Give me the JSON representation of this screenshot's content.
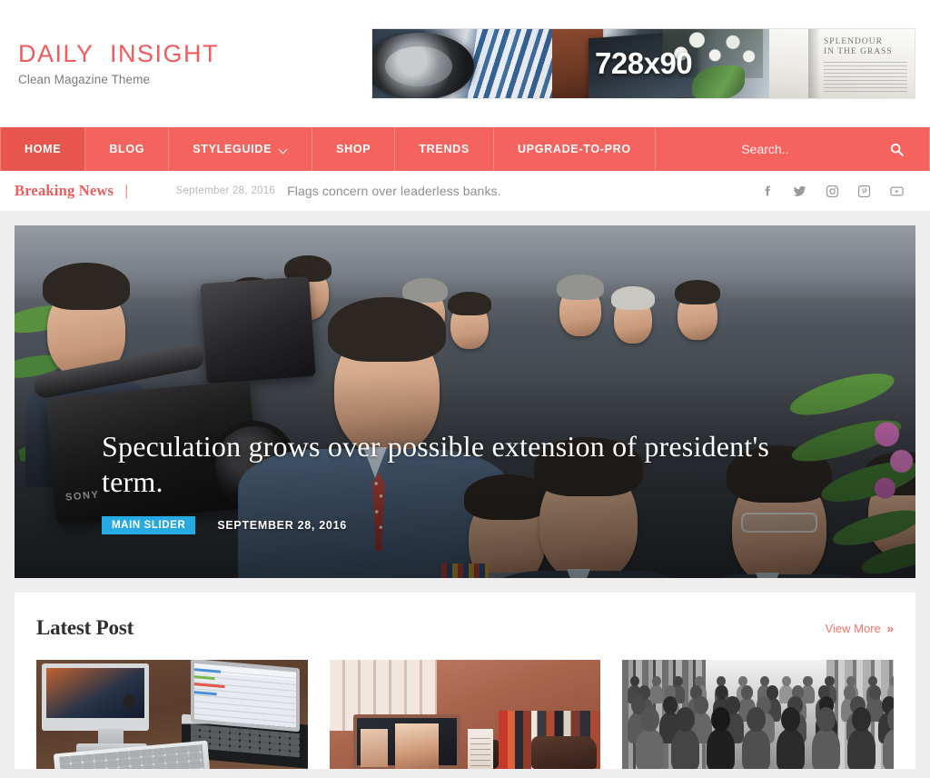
{
  "brand": {
    "title": "DAILY  INSIGHT",
    "tagline": "Clean Magazine Theme"
  },
  "banner": {
    "label": "728x90",
    "book_text": "SPLENDOUR\nIN THE GRASS"
  },
  "nav": {
    "items": [
      {
        "label": "HOME",
        "active": true,
        "has_dropdown": false
      },
      {
        "label": "BLOG",
        "active": false,
        "has_dropdown": false
      },
      {
        "label": "STYLEGUIDE",
        "active": false,
        "has_dropdown": true
      },
      {
        "label": "SHOP",
        "active": false,
        "has_dropdown": false
      },
      {
        "label": "TRENDS",
        "active": false,
        "has_dropdown": false
      },
      {
        "label": "UPGRADE-TO-PRO",
        "active": false,
        "has_dropdown": false
      }
    ],
    "search": {
      "placeholder": "Search..",
      "value": "",
      "icon": "search-icon"
    },
    "background_color": "#f4635e",
    "active_color": "#e8554f"
  },
  "breaking": {
    "label": "Breaking News",
    "separator": "|",
    "date": "September 28, 2016",
    "headline": "Flags concern over leaderless banks.",
    "social": [
      {
        "name": "facebook",
        "icon": "facebook-icon"
      },
      {
        "name": "twitter",
        "icon": "twitter-icon"
      },
      {
        "name": "instagram",
        "icon": "instagram-icon"
      },
      {
        "name": "pinterest",
        "icon": "pinterest-icon"
      },
      {
        "name": "youtube",
        "icon": "youtube-icon"
      }
    ]
  },
  "slider": {
    "title": "Speculation grows over possible extension of president's term.",
    "category": "MAIN SLIDER",
    "category_color": "#27a9e1",
    "date": "SEPTEMBER 28, 2016"
  },
  "latest": {
    "heading": "Latest Post",
    "view_more": "View More",
    "view_more_chevron": "»",
    "view_more_color": "#f4736d",
    "posts": [
      {
        "name": "post-imac-desk"
      },
      {
        "name": "post-warm-desk"
      },
      {
        "name": "post-street-crowd"
      }
    ]
  },
  "theme": {
    "accent": "#f15b5b",
    "nav": "#f4635e",
    "page_background": "#eeeeee",
    "panel_background": "#ffffff"
  }
}
